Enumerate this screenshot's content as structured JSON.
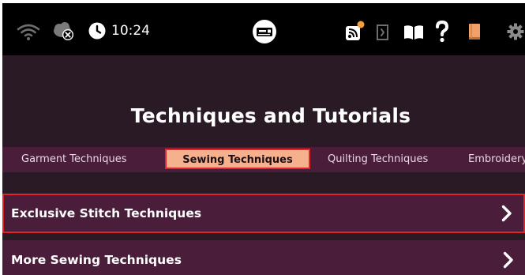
{
  "statusbar": {
    "time": "10:24",
    "icons": [
      "wifi-icon",
      "cloud-offline-icon",
      "clock-icon",
      "sewing-machine-icon",
      "remote-notification-icon",
      "exit-icon",
      "book-icon",
      "help-icon",
      "notebook-icon",
      "settings-icon"
    ]
  },
  "page": {
    "title": "Techniques and Tutorials"
  },
  "tabs": [
    {
      "label": "Garment Techniques"
    },
    {
      "label": "Sewing Techniques",
      "active": true
    },
    {
      "label": "Quilting Techniques"
    },
    {
      "label": "Embroidery Techniques"
    }
  ],
  "list": [
    {
      "label": "Exclusive Stitch Techniques",
      "focused": true
    },
    {
      "label": "More Sewing Techniques"
    }
  ],
  "colors": {
    "statusbar_bg": "#000000",
    "screen_bg": "#2a1a26",
    "bar_bg": "#4a1e3a",
    "active_tab_bg": "#f5b08d",
    "focus_border": "#e0262b",
    "notification_dot": "#f5a036",
    "notebook_icon": "#f2a06a"
  }
}
